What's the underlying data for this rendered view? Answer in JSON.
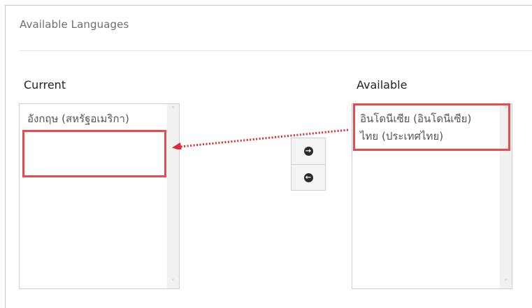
{
  "panel": {
    "title": "Available Languages"
  },
  "current": {
    "label": "Current",
    "items": [
      "อังกฤษ (สหรัฐอเมริกา)"
    ]
  },
  "available": {
    "label": "Available",
    "items": [
      "อินโดนีเซีย (อินโดนีเซีย)",
      "ไทย (ประเทศไทย)"
    ]
  },
  "buttons": {
    "move_right_icon": "arrow-right-circle-icon",
    "move_left_icon": "arrow-left-circle-icon"
  },
  "colors": {
    "highlight": "#e84a4f",
    "annotation_arrow": "#e02b35"
  }
}
